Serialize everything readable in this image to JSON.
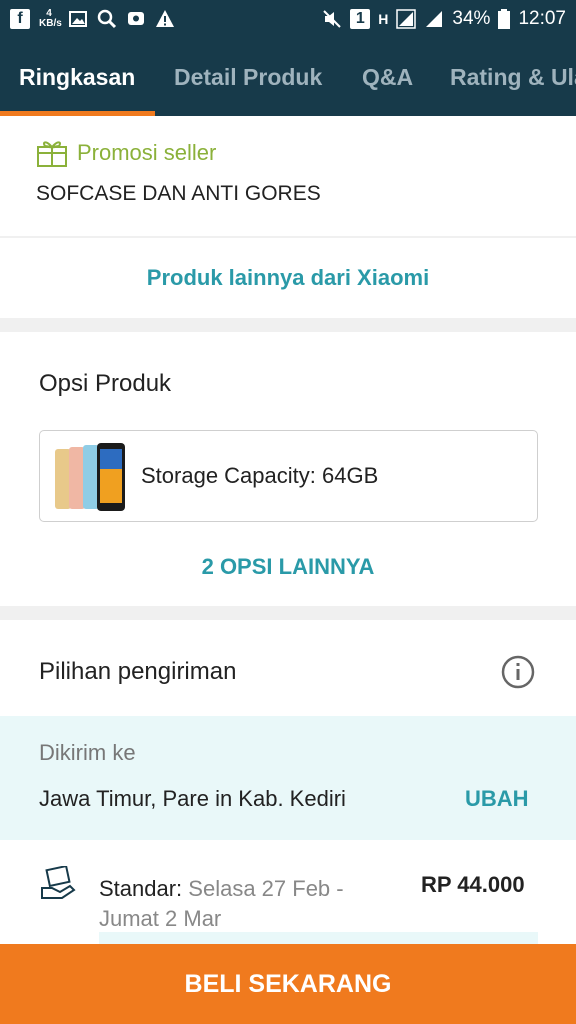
{
  "status_bar": {
    "kbs": "4 KB/s",
    "sim": "1",
    "network": "H",
    "battery": "34%",
    "time": "12:07"
  },
  "tabs": [
    {
      "label": "Ringkasan",
      "active": true
    },
    {
      "label": "Detail Produk",
      "active": false
    },
    {
      "label": "Q&A",
      "active": false
    },
    {
      "label": "Rating & Ulasan",
      "active": false
    }
  ],
  "promo": {
    "label": "Promosi seller",
    "text": "SOFCASE DAN ANTI GORES",
    "icon": "gift-icon"
  },
  "other_products_link": "Produk lainnya dari Xiaomi",
  "options": {
    "title": "Opsi Produk",
    "selected": "Storage Capacity: 64GB",
    "more": "2 OPSI LAINNYA"
  },
  "shipping": {
    "title": "Pilihan pengiriman",
    "destination_label": "Dikirim ke",
    "destination": "Jawa Timur, Pare in Kab. Kediri",
    "change": "UBAH",
    "service_name": "Standar:",
    "service_dates": "Selasa 27 Feb - Jumat 2 Mar",
    "service_price": "RP 44.000"
  },
  "buy_button": "BELI SEKARANG",
  "colors": {
    "header_bg": "#173a4a",
    "accent_orange": "#f07a1e",
    "link_teal": "#2a9aa8",
    "promo_green": "#8bb13a"
  }
}
